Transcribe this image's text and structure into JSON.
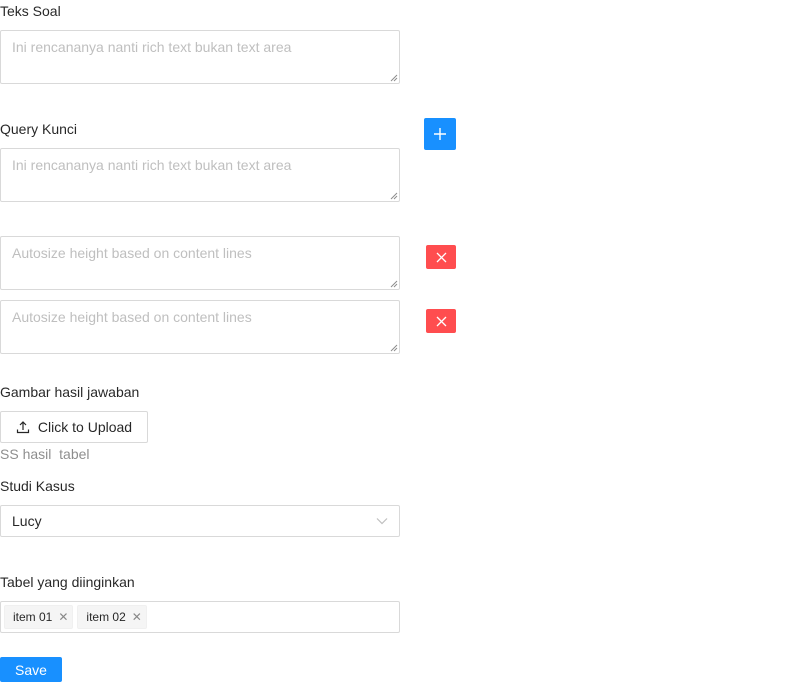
{
  "form": {
    "teks_soal": {
      "label": "Teks Soal",
      "placeholder": "Ini rencananya nanti rich text bukan text area"
    },
    "query_kunci": {
      "label": "Query Kunci",
      "placeholder": "Ini rencananya nanti rich text bukan text area",
      "add_icon": "plus-icon"
    },
    "extra_queries": [
      {
        "placeholder": "Autosize height based on content lines",
        "delete_icon": "close-icon"
      },
      {
        "placeholder": "Autosize height based on content lines",
        "delete_icon": "close-icon"
      }
    ],
    "gambar": {
      "label": "Gambar hasil jawaban",
      "upload_label": "Click to Upload",
      "upload_icon": "upload-icon",
      "file_name": "SS hasil  tabel"
    },
    "studi_kasus": {
      "label": "Studi Kasus",
      "selected": "Lucy",
      "arrow_icon": "chevron-down-icon"
    },
    "tabel": {
      "label": "Tabel yang diinginkan",
      "tags": [
        "item 01",
        "item 02"
      ]
    },
    "save_label": "Save"
  },
  "colors": {
    "primary": "#1890ff",
    "danger": "#ff4d4f",
    "border": "#d9d9d9",
    "placeholder": "#bfbfbf"
  }
}
